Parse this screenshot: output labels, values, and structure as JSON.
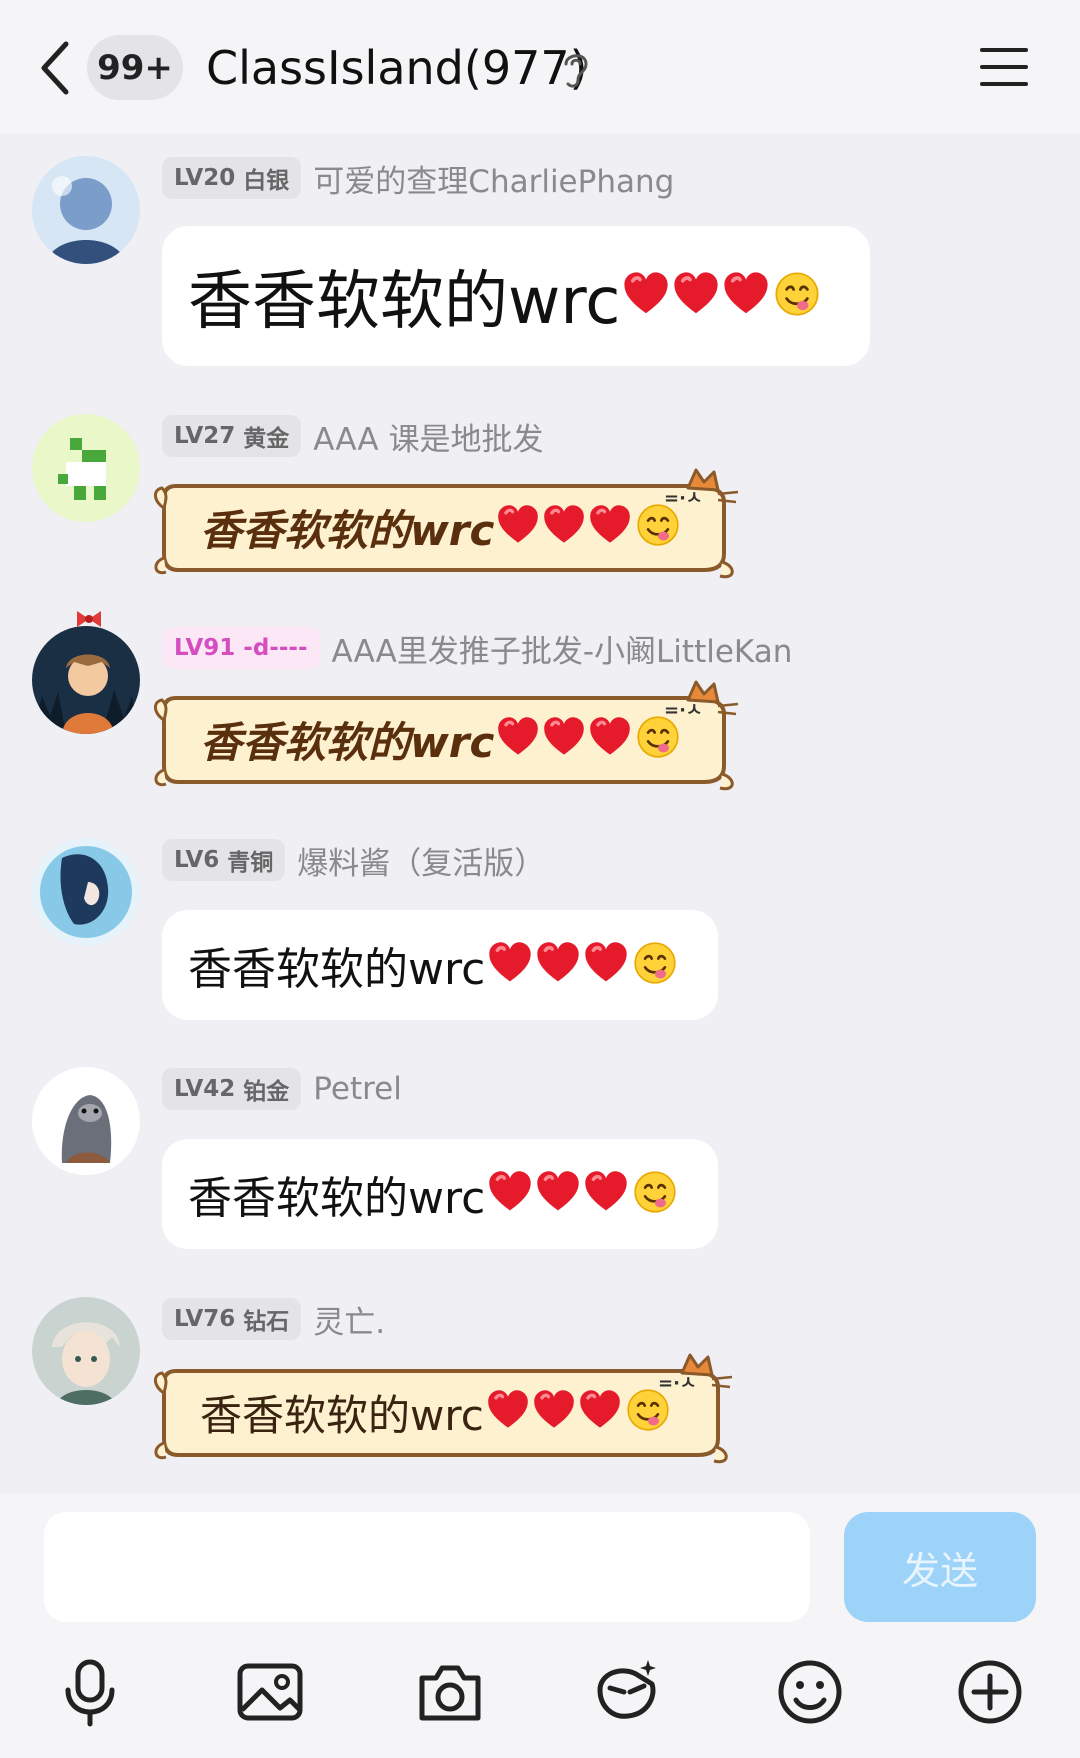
{
  "header": {
    "unread_count": "99+",
    "title": "ClassIsland(977)"
  },
  "messages": [
    {
      "level": "LV20",
      "rank": "白银",
      "name": "可爱的查理CharliePhang",
      "text": "香香软软的wrc",
      "style": "plain-large",
      "avatar_colors": [
        "#7a9dc9",
        "#d6e6f4",
        "#33507d"
      ]
    },
    {
      "level": "LV27",
      "rank": "黄金",
      "name": "AAA 课是地批发",
      "text": "香香软软的wrc",
      "style": "cat",
      "avatar_colors": [
        "#e9f7c9",
        "#4aa83a",
        "#ffffff"
      ]
    },
    {
      "level": "LV91",
      "rank": "-d----",
      "name": "AAA里发推子批发-小阚LittleKan",
      "text": "香香软软的wrc",
      "style": "cat",
      "avatar_colors": [
        "#2b4d6b",
        "#e07a3a",
        "#1b2f44"
      ]
    },
    {
      "level": "LV6",
      "rank": "青铜",
      "name": "爆料酱（复活版）",
      "text": "香香软软的wrc",
      "style": "plain",
      "avatar_colors": [
        "#3aa5d8",
        "#e6f3fb",
        "#1d3a5c"
      ]
    },
    {
      "level": "LV42",
      "rank": "铂金",
      "name": "Petrel",
      "text": "香香软软的wrc",
      "style": "plain",
      "avatar_colors": [
        "#ffffff",
        "#6b6f7a",
        "#a3a6ad"
      ]
    },
    {
      "level": "LV76",
      "rank": "钻石",
      "name": "灵亡.",
      "text": "香香软软的wrc",
      "style": "cat-regular",
      "avatar_colors": [
        "#c9d3d0",
        "#e8e3da",
        "#4e6d63"
      ]
    }
  ],
  "heart_count": 3,
  "emoji": "smiling-face-savoring-food",
  "input": {
    "placeholder": "",
    "send_label": "发送"
  },
  "toolbar": [
    "microphone-icon",
    "image-icon",
    "camera-icon",
    "red-packet-icon",
    "emoji-icon",
    "plus-icon"
  ],
  "colors": {
    "send_button": "#9dd3f8",
    "cat_bubble_fill": "#fdf1cf",
    "cat_bubble_border": "#8a5a2b",
    "heart": "#e51b2c",
    "emoji": "#ffd23a",
    "level_pink": "#d54ec1"
  }
}
